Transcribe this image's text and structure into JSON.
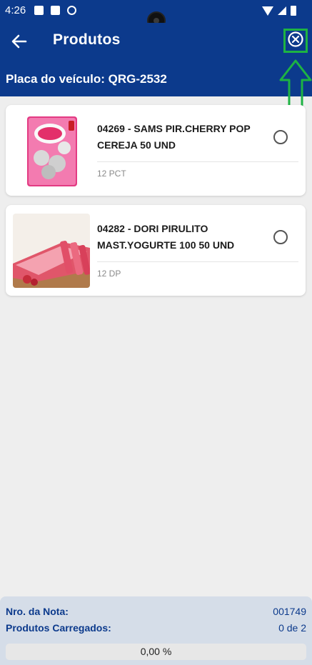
{
  "status_bar": {
    "time": "4:26"
  },
  "header": {
    "title": "Produtos",
    "plate_label": "Placa do veículo:",
    "plate_value": "QRG-2532",
    "back_icon": "arrow-left-icon",
    "close_icon": "close-circle-icon"
  },
  "products": [
    {
      "name": "04269 - SAMS PIR.CHERRY POP CEREJA 50 UND",
      "quantity": "12 PCT",
      "selected": false
    },
    {
      "name": "04282 - DORI PIRULITO MAST.YOGURTE 100 50 UND",
      "quantity": "12 DP",
      "selected": false
    }
  ],
  "footer": {
    "invoice_label": "Nro. da Nota:",
    "invoice_value": "001749",
    "loaded_label": "Produtos Carregados:",
    "loaded_value": "0 de 2",
    "progress_text": "0,00 %",
    "progress_fraction": 0
  },
  "colors": {
    "primary": "#0c3a8c",
    "annotation": "#1db343",
    "background": "#eeeeee"
  }
}
